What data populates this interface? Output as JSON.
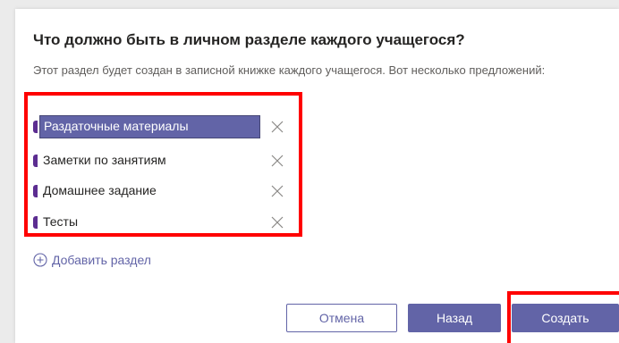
{
  "dialog": {
    "title": "Что должно быть в личном разделе каждого учащегося?",
    "description": "Этот раздел будет создан в записной книжке каждого учащегося. Вот несколько предложений:"
  },
  "sections": [
    {
      "label": "Раздаточные материалы",
      "selected": true,
      "remove_icon": "close-icon"
    },
    {
      "label": "Заметки по занятиям",
      "selected": false,
      "remove_icon": "close-icon"
    },
    {
      "label": "Домашнее задание",
      "selected": false,
      "remove_icon": "close-icon"
    },
    {
      "label": "Тесты",
      "selected": false,
      "remove_icon": "close-icon"
    }
  ],
  "add_section": {
    "label": "Добавить раздел",
    "icon": "plus-circle-icon"
  },
  "buttons": {
    "cancel": "Отмена",
    "back": "Назад",
    "create": "Создать"
  },
  "colors": {
    "accent": "#6264a7",
    "section_marker": "#5c2d91",
    "highlight": "#ff0000"
  }
}
